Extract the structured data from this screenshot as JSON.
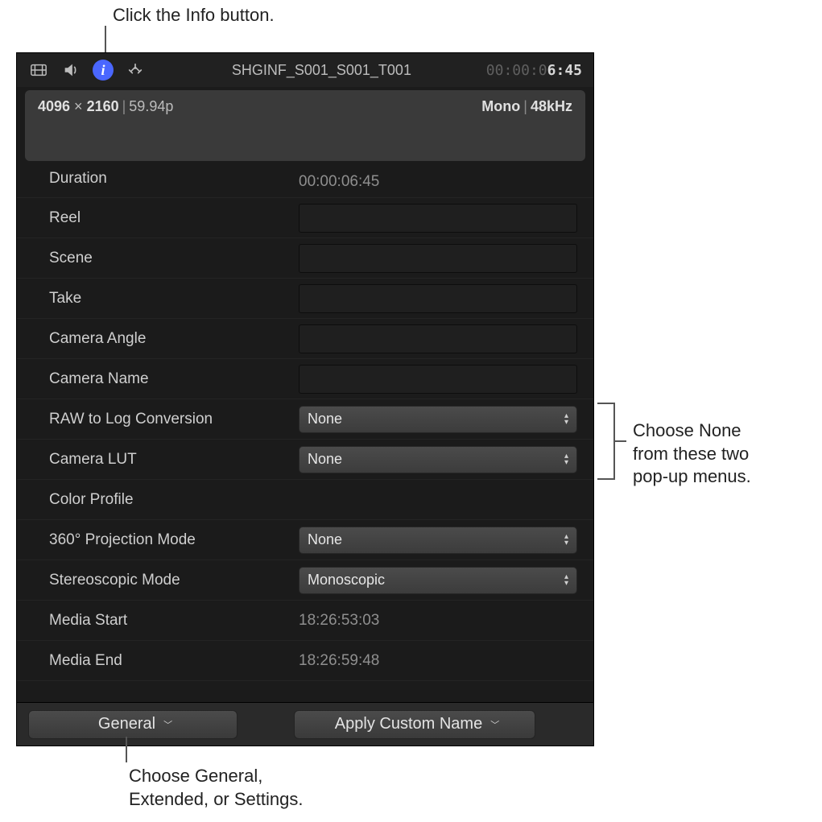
{
  "callouts": {
    "top": "Click the Info button.",
    "right_l1": "Choose None",
    "right_l2": "from these two",
    "right_l3": "pop-up menus.",
    "bottom_l1": "Choose General,",
    "bottom_l2": "Extended, or Settings."
  },
  "toolbar": {
    "clip_title": "SHGINF_S001_S001_T001",
    "timecode_gray": "00:00:0",
    "timecode_bold": "6:45"
  },
  "summary": {
    "res_w": "4096",
    "res_h": "2160",
    "fps": "59.94p",
    "audio_ch": "Mono",
    "audio_sr": "48kHz"
  },
  "rows": {
    "duration_label": "Duration",
    "duration_value": "00:00:06:45",
    "reel_label": "Reel",
    "scene_label": "Scene",
    "take_label": "Take",
    "cam_angle_label": "Camera Angle",
    "cam_name_label": "Camera Name",
    "raw_log_label": "RAW to Log Conversion",
    "raw_log_value": "None",
    "cam_lut_label": "Camera LUT",
    "cam_lut_value": "None",
    "color_profile_label": "Color Profile",
    "proj360_label": "360° Projection Mode",
    "proj360_value": "None",
    "stereo_label": "Stereoscopic Mode",
    "stereo_value": "Monoscopic",
    "media_start_label": "Media Start",
    "media_start_value": "18:26:53:03",
    "media_end_label": "Media End",
    "media_end_value": "18:26:59:48"
  },
  "bottom": {
    "view_label": "General",
    "apply_label": "Apply Custom Name"
  }
}
